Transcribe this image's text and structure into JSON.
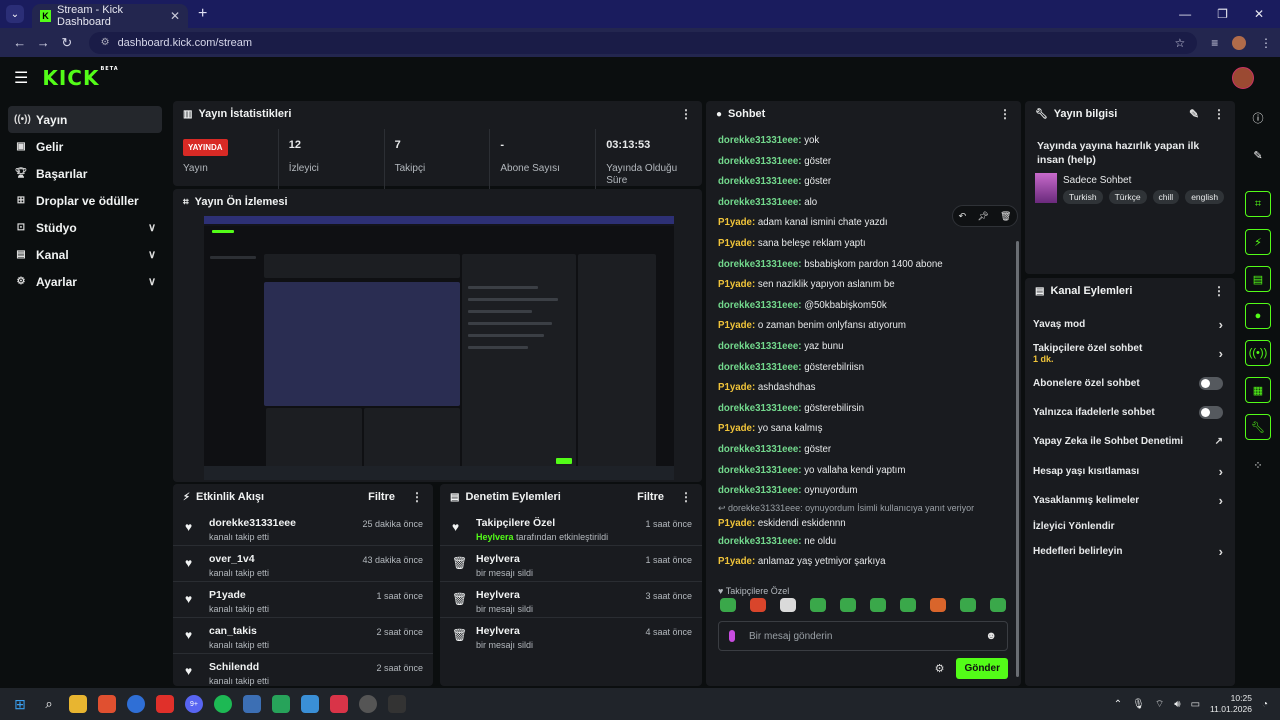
{
  "browser": {
    "tab_title": "Stream - Kick Dashboard",
    "tab_favicon": "K",
    "url": "dashboard.kick.com/stream"
  },
  "header": {
    "logo": "KICK",
    "logo_badge": "BETA"
  },
  "sidebar": {
    "items": [
      {
        "label": "Yayın",
        "icon": "broadcast-icon"
      },
      {
        "label": "Gelir",
        "icon": "revenue-icon"
      },
      {
        "label": "Başarılar",
        "icon": "trophy-icon"
      },
      {
        "label": "Droplar ve ödüller",
        "icon": "drops-icon"
      },
      {
        "label": "Stüdyo",
        "icon": "studio-icon"
      },
      {
        "label": "Kanal",
        "icon": "channel-icon"
      },
      {
        "label": "Ayarlar",
        "icon": "settings-icon"
      }
    ]
  },
  "stats_panel": {
    "title": "Yayın İstatistikleri",
    "live_badge": "YAYINDA",
    "stats": [
      {
        "value": "",
        "label": "Yayın"
      },
      {
        "value": "12",
        "label": "İzleyici"
      },
      {
        "value": "7",
        "label": "Takipçi"
      },
      {
        "value": "-",
        "label": "Abone Sayısı"
      },
      {
        "value": "03:13:53",
        "label": "Yayında Olduğu Süre"
      }
    ]
  },
  "preview_panel": {
    "title": "Yayın Ön İzlemesi"
  },
  "activity_panel": {
    "title": "Etkinlik Akışı",
    "filter": "Filtre",
    "rows": [
      {
        "name": "dorekke31331eee",
        "desc": "kanalı takip etti",
        "time": "25 dakika önce"
      },
      {
        "name": "over_1v4",
        "desc": "kanalı takip etti",
        "time": "43 dakika önce"
      },
      {
        "name": "P1yade",
        "desc": "kanalı takip etti",
        "time": "1 saat önce"
      },
      {
        "name": "can_takis",
        "desc": "kanalı takip etti",
        "time": "2 saat önce"
      },
      {
        "name": "Schilendd",
        "desc": "kanalı takip etti",
        "time": "2 saat önce"
      }
    ]
  },
  "moderation_panel": {
    "title": "Denetim Eylemleri",
    "filter": "Filtre",
    "rows": [
      {
        "name": "Takipçilere Özel",
        "actor": "Heylvera",
        "desc": " tarafından etkinleştirildi",
        "time": "1 saat önce",
        "icon": "heart"
      },
      {
        "name": "Heylvera",
        "actor": "",
        "desc": "bir mesajı sildi",
        "time": "1 saat önce",
        "icon": "trash"
      },
      {
        "name": "Heylvera",
        "actor": "",
        "desc": "bir mesajı sildi",
        "time": "3 saat önce",
        "icon": "trash"
      },
      {
        "name": "Heylvera",
        "actor": "",
        "desc": "bir mesajı sildi",
        "time": "4 saat önce",
        "icon": "trash"
      }
    ]
  },
  "chat_panel": {
    "title": "Sohbet",
    "messages": [
      {
        "user": "dorekke31331eee",
        "text": "yok",
        "type": "u1"
      },
      {
        "user": "dorekke31331eee",
        "text": "göster",
        "type": "u1"
      },
      {
        "user": "dorekke31331eee",
        "text": "göster",
        "type": "u1"
      },
      {
        "user": "dorekke31331eee",
        "text": "alo",
        "type": "u1"
      },
      {
        "user": "P1yade",
        "text": "adam kanal ismini chate yazdı",
        "type": "u2"
      },
      {
        "user": "P1yade",
        "text": "sana beleşe reklam yaptı",
        "type": "u2"
      },
      {
        "user": "dorekke31331eee",
        "text": "bsbabişkom pardon 1400 abone",
        "type": "u1"
      },
      {
        "user": "P1yade",
        "text": "sen naziklik yapıyon aslanım be",
        "type": "u2"
      },
      {
        "user": "dorekke31331eee",
        "text": "@50kbabişkom50k",
        "type": "u1"
      },
      {
        "user": "P1yade",
        "text": "o zaman benim onlyfansı atıyorum",
        "type": "u2"
      },
      {
        "user": "dorekke31331eee",
        "text": "yaz bunu",
        "type": "u1"
      },
      {
        "user": "dorekke31331eee",
        "text": "gösterebilriisn",
        "type": "u1"
      },
      {
        "user": "P1yade",
        "text": "ashdashdhas",
        "type": "u2"
      },
      {
        "user": "dorekke31331eee",
        "text": "gösterebilirsin",
        "type": "u1"
      },
      {
        "user": "P1yade",
        "text": "yo sana kalmış",
        "type": "u2"
      },
      {
        "user": "dorekke31331eee",
        "text": "göster",
        "type": "u1"
      },
      {
        "user": "dorekke31331eee",
        "text": "yo vallaha kendi yaptım",
        "type": "u1"
      },
      {
        "user": "dorekke31331eee",
        "text": "oynuyordum",
        "type": "u1"
      }
    ],
    "reply_ref": "dorekke31331eee: oynuyordum İsimli kullanıcıya yanıt veriyor",
    "messages_after": [
      {
        "user": "P1yade",
        "text": "eskidendi eskidennn",
        "type": "u2"
      },
      {
        "user": "dorekke31331eee",
        "text": "ne oldu",
        "type": "u1"
      },
      {
        "user": "P1yade",
        "text": "anlamaz yaş yetmiyor şarkıya",
        "type": "u2"
      }
    ],
    "followers_only": "Takipçilere Özel",
    "input_placeholder": "Bir mesaj gönderin",
    "send_label": "Gönder"
  },
  "info_panel": {
    "title": "Yayın bilgisi",
    "stream_title": "Yayında yayına hazırlık yapan ilk insan (help)",
    "category": "Sadece Sohbet",
    "tags": [
      "Turkish",
      "Türkçe",
      "chill",
      "english"
    ]
  },
  "channel_actions": {
    "title": "Kanal Eylemleri",
    "items": [
      {
        "label": "Yavaş mod",
        "sub": "",
        "control": "chevron"
      },
      {
        "label": "Takipçilere özel sohbet",
        "sub": "1 dk.",
        "control": "chevron"
      },
      {
        "label": "Abonelere özel sohbet",
        "sub": "",
        "control": "toggle"
      },
      {
        "label": "Yalnızca ifadelerle sohbet",
        "sub": "",
        "control": "toggle"
      },
      {
        "label": "Yapay Zeka ile Sohbet Denetimi",
        "sub": "",
        "control": "external"
      },
      {
        "label": "Hesap yaşı kısıtlaması",
        "sub": "",
        "control": "chevron"
      },
      {
        "label": "Yasaklanmış kelimeler",
        "sub": "",
        "control": "chevron"
      },
      {
        "label": "İzleyici Yönlendir",
        "sub": "",
        "control": "none"
      },
      {
        "label": "Hedefleri belirleyin",
        "sub": "",
        "control": "chevron"
      }
    ]
  },
  "taskbar": {
    "time": "10:25",
    "date": "11.01.2026",
    "discord_badge": "9+"
  },
  "colors": {
    "accent": "#53fc18",
    "live": "#d82a25",
    "user_green": "#73d98d",
    "user_yellow": "#f0c43a"
  }
}
